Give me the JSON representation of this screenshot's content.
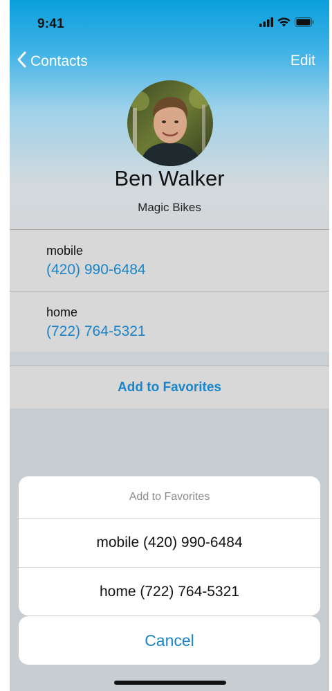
{
  "status_bar": {
    "time": "9:41",
    "icons": [
      "cellular-signal-icon",
      "wifi-icon",
      "battery-icon"
    ]
  },
  "nav": {
    "back_label": "Contacts",
    "back_icon": "chevron-left-icon",
    "edit_label": "Edit"
  },
  "contact": {
    "name": "Ben Walker",
    "company": "Magic Bikes",
    "phones": [
      {
        "label": "mobile",
        "number": "(420) 990-6484"
      },
      {
        "label": "home",
        "number": "(722) 764-5321"
      }
    ],
    "add_favorites_label": "Add to Favorites"
  },
  "action_sheet": {
    "title": "Add to Favorites",
    "options": [
      "mobile (420) 990-6484",
      "home (722) 764-5321"
    ],
    "cancel_label": "Cancel"
  },
  "colors": {
    "accent": "#1a84c9",
    "header_top": "#0a9fdc",
    "background": "#c8cdd2"
  }
}
